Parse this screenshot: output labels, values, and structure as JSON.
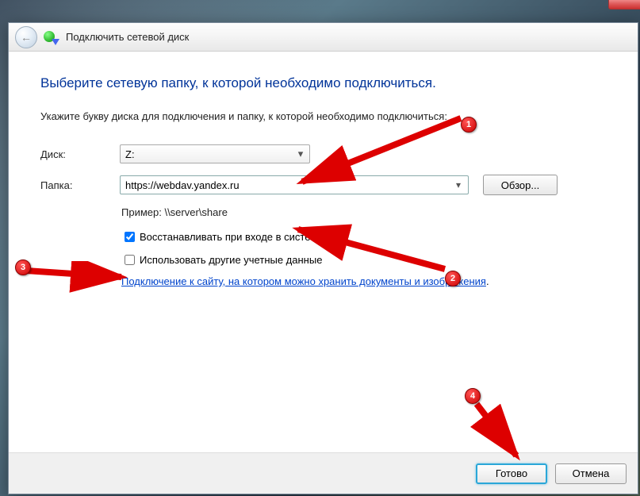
{
  "window": {
    "title": "Подключить сетевой диск"
  },
  "heading": "Выберите сетевую папку, к которой необходимо подключиться.",
  "subtext": "Укажите букву диска для подключения и папку, к которой необходимо подключиться:",
  "labels": {
    "drive": "Диск:",
    "folder": "Папка:"
  },
  "drive_value": "Z:",
  "folder_value": "https://webdav.yandex.ru",
  "browse_label": "Обзор...",
  "example_label": "Пример: \\\\server\\share",
  "checkbox_reconnect": "Восстанавливать при входе в систему",
  "checkbox_othercreds": "Использовать другие учетные данные",
  "link_text": "Подключение к сайту, на котором можно хранить документы и изображения",
  "footer": {
    "ok": "Готово",
    "cancel": "Отмена"
  },
  "annotations": {
    "b1": "1",
    "b2": "2",
    "b3": "3",
    "b4": "4"
  }
}
